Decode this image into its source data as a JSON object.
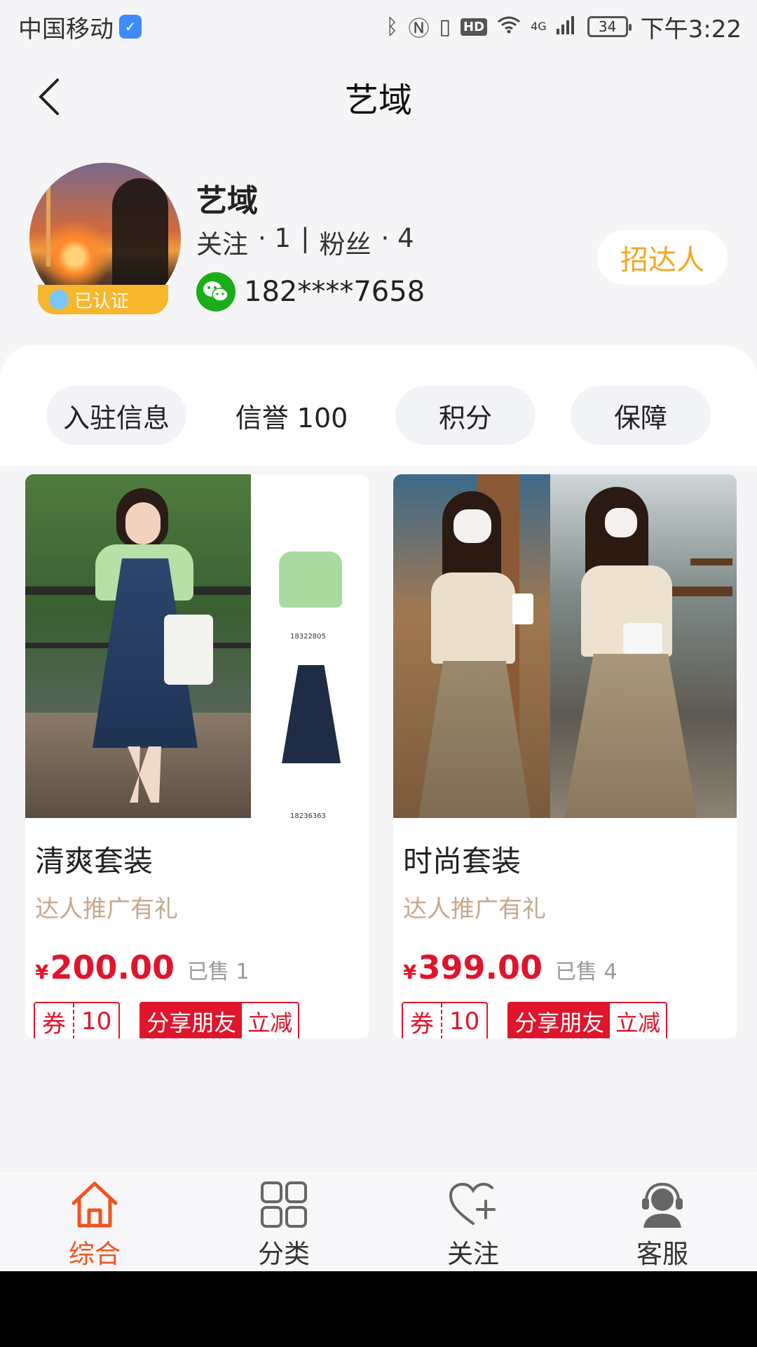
{
  "status_bar": {
    "carrier": "中国移动",
    "icons": [
      "bluetooth-icon",
      "nfc-icon",
      "vibrate-icon",
      "hd-icon",
      "wifi-icon",
      "signal-icon"
    ],
    "network": "4G",
    "hd": "HD",
    "battery": "34",
    "time": "下午3:22"
  },
  "nav": {
    "title": "艺域",
    "back_icon": "chevron-left-icon"
  },
  "profile": {
    "name": "艺域",
    "follow_label": "关注",
    "follow_count": "· 1",
    "separator": "|",
    "fans_label": "粉丝",
    "fans_count": "· 4",
    "verified_label": "已认证",
    "phone": "182****7658",
    "recruit_button": "招达人"
  },
  "tabs": [
    {
      "label": "入驻信息"
    },
    {
      "label": "信誉 100"
    },
    {
      "label": "积分"
    },
    {
      "label": "保障"
    }
  ],
  "products": [
    {
      "title": "清爽套装",
      "promo": "达人推广有礼",
      "currency": "¥",
      "price": "200.00",
      "sold": "已售 1",
      "coupon_label": "券",
      "coupon_value": "10",
      "share_label": "分享朋友",
      "share_action": "立减",
      "image_codes": [
        "18322805",
        "18236363"
      ]
    },
    {
      "title": "时尚套装",
      "promo": "达人推广有礼",
      "currency": "¥",
      "price": "399.00",
      "sold": "已售 4",
      "coupon_label": "券",
      "coupon_value": "10",
      "share_label": "分享朋友",
      "share_action": "立减"
    }
  ],
  "bottom_nav": [
    {
      "label": "综合",
      "icon": "home-icon",
      "active": true
    },
    {
      "label": "分类",
      "icon": "grid-icon",
      "active": false
    },
    {
      "label": "关注",
      "icon": "heart-plus-icon",
      "active": false
    },
    {
      "label": "客服",
      "icon": "customer-service-icon",
      "active": false
    }
  ],
  "colors": {
    "accent": "#f0541e",
    "price_red": "#e0142a",
    "recruit_gold": "#f5a623",
    "promo_tan": "#c7a88c"
  }
}
